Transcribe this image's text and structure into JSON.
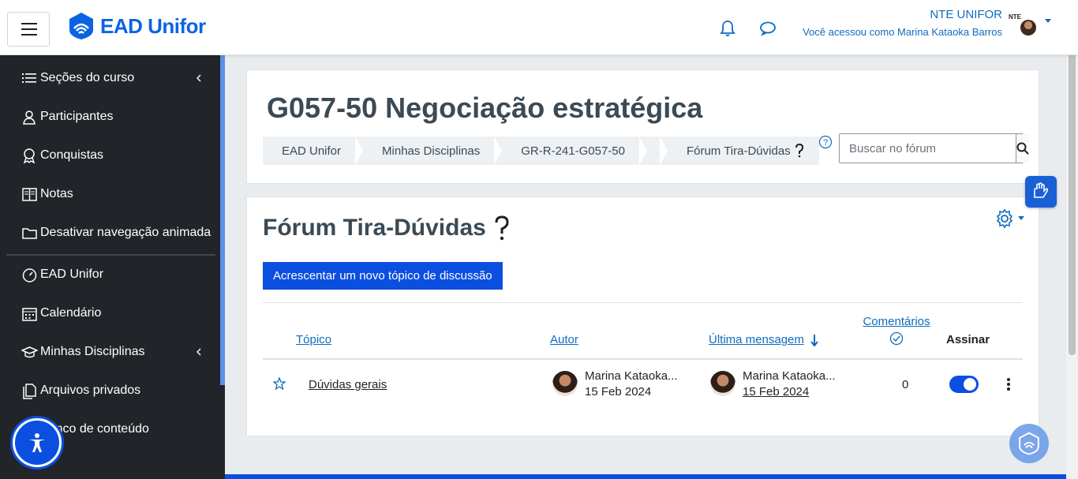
{
  "brand": {
    "name": "EAD Unifor"
  },
  "header": {
    "user_org": "NTE UNIFOR",
    "user_login": "Você acessou como Marina Kataoka Barros",
    "logo_text": "NTE"
  },
  "sidebar": {
    "items": [
      {
        "label": "Seções do curso",
        "icon": "list-icon",
        "chevron": true
      },
      {
        "label": "Participantes",
        "icon": "users-icon",
        "chevron": false
      },
      {
        "label": "Conquistas",
        "icon": "badge-icon",
        "chevron": false
      },
      {
        "label": "Notas",
        "icon": "grades-icon",
        "chevron": false
      },
      {
        "label": "Desativar navegação animada",
        "icon": "folder-icon",
        "chevron": false
      },
      {
        "label": "EAD Unifor",
        "icon": "dashboard-icon",
        "chevron": false
      },
      {
        "label": "Calendário",
        "icon": "calendar-icon",
        "chevron": false
      },
      {
        "label": "Minhas Disciplinas",
        "icon": "graduation-cap-icon",
        "chevron": true
      },
      {
        "label": "Arquivos privados",
        "icon": "files-icon",
        "chevron": false
      },
      {
        "label": "Banco de conteúdo",
        "icon": "content-bank-icon",
        "chevron": false
      }
    ]
  },
  "page": {
    "title": "G057-50 Negociação estratégica",
    "breadcrumb": [
      "EAD Unifor",
      "Minhas Disciplinas",
      "GR-R-241-G057-50",
      "",
      "Fórum Tira-Dúvidas"
    ]
  },
  "search": {
    "placeholder": "Buscar no fórum"
  },
  "forum": {
    "title": "Fórum Tira-Dúvidas",
    "add_topic_label": "Acrescentar um novo tópico de discussão",
    "columns": {
      "topic": "Tópico",
      "author": "Autor",
      "last_message": "Última mensagem",
      "comments": "Comentários",
      "subscribe": "Assinar"
    },
    "rows": [
      {
        "topic": "Dúvidas gerais",
        "author_name": "Marina Kataoka...",
        "author_date": "15 Feb 2024",
        "last_name": "Marina Kataoka...",
        "last_date": "15 Feb 2024",
        "comments": "0",
        "subscribed": true
      }
    ]
  },
  "colors": {
    "primary": "#0b4fe0",
    "sidebar": "#212529",
    "link": "#0f6cbf"
  }
}
